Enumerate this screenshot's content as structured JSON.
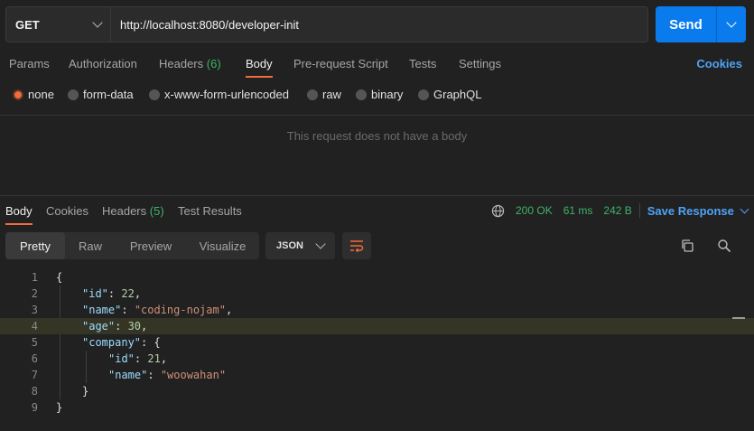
{
  "request": {
    "method": "GET",
    "url": "http://localhost:8080/developer-init",
    "send_label": "Send"
  },
  "request_tabs": {
    "params": "Params",
    "authorization": "Authorization",
    "headers": "Headers",
    "headers_count": "(6)",
    "body": "Body",
    "prerequest": "Pre-request Script",
    "tests": "Tests",
    "settings": "Settings",
    "cookies": "Cookies"
  },
  "body_types": {
    "none": "none",
    "form_data": "form-data",
    "urlencoded": "x-www-form-urlencoded",
    "raw": "raw",
    "binary": "binary",
    "graphql": "GraphQL",
    "selected": "none"
  },
  "empty_body_message": "This request does not have a body",
  "response_tabs": {
    "body": "Body",
    "cookies": "Cookies",
    "headers": "Headers",
    "headers_count": "(5)",
    "test_results": "Test Results"
  },
  "response_status": {
    "status": "200 OK",
    "time": "61 ms",
    "size": "242 B",
    "save_response": "Save Response"
  },
  "view_modes": {
    "pretty": "Pretty",
    "raw": "Raw",
    "preview": "Preview",
    "visualize": "Visualize",
    "format": "JSON"
  },
  "code_lines": [
    {
      "n": "1",
      "text": "{"
    },
    {
      "n": "2",
      "key": "\"id\"",
      "sep": ": ",
      "num": "22",
      "tail": ","
    },
    {
      "n": "3",
      "key": "\"name\"",
      "sep": ": ",
      "str": "\"coding-nojam\"",
      "tail": ","
    },
    {
      "n": "4",
      "key": "\"age\"",
      "sep": ": ",
      "num": "30",
      "tail": ","
    },
    {
      "n": "5",
      "key": "\"company\"",
      "sep": ": ",
      "tail": "{"
    },
    {
      "n": "6",
      "key": "\"id\"",
      "sep": ": ",
      "num": "21",
      "tail": ","
    },
    {
      "n": "7",
      "key": "\"name\"",
      "sep": ": ",
      "str": "\"woowahan\""
    },
    {
      "n": "8",
      "text": "}"
    },
    {
      "n": "9",
      "text": "}"
    }
  ],
  "colors": {
    "accent_orange": "#f26b3a",
    "send_blue": "#097bed",
    "status_green": "#3eb36a",
    "link_blue": "#4ea3f5"
  }
}
